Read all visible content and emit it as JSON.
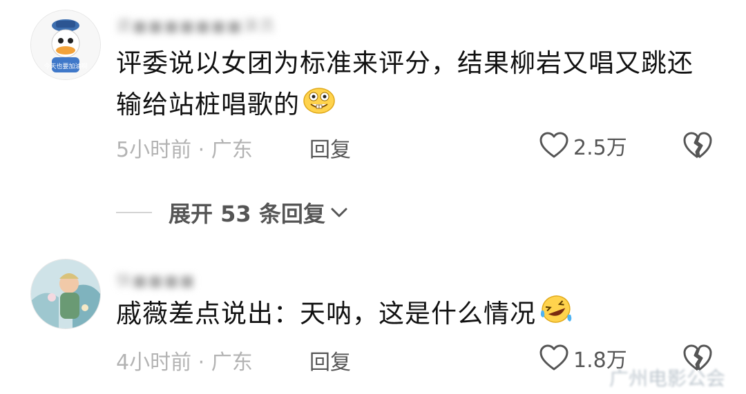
{
  "comments": [
    {
      "username": "退■■■■■■■演员",
      "avatar_text": "今天也要加油啊",
      "text": "评委说以女团为标准来评分，结果柳岩又唱又跳还输给站桩唱歌的",
      "emoji": "grinning-teeth-emoji",
      "time_location": "5小时前 · 广东",
      "reply_label": "回复",
      "like_count": "2.5万"
    },
    {
      "username": "快■■■■",
      "text": "戚薇差点说出：天呐，这是什么情况",
      "emoji": "laughing-tears-emoji",
      "time_location": "4小时前 · 广东",
      "reply_label": "回复",
      "like_count": "1.8万"
    }
  ],
  "expand_replies": {
    "label": "展开 53 条回复"
  },
  "watermark": "广州电影公会",
  "colors": {
    "secondary_text": "#b3b3b3",
    "action_text": "#555555",
    "body_text": "#111111"
  }
}
